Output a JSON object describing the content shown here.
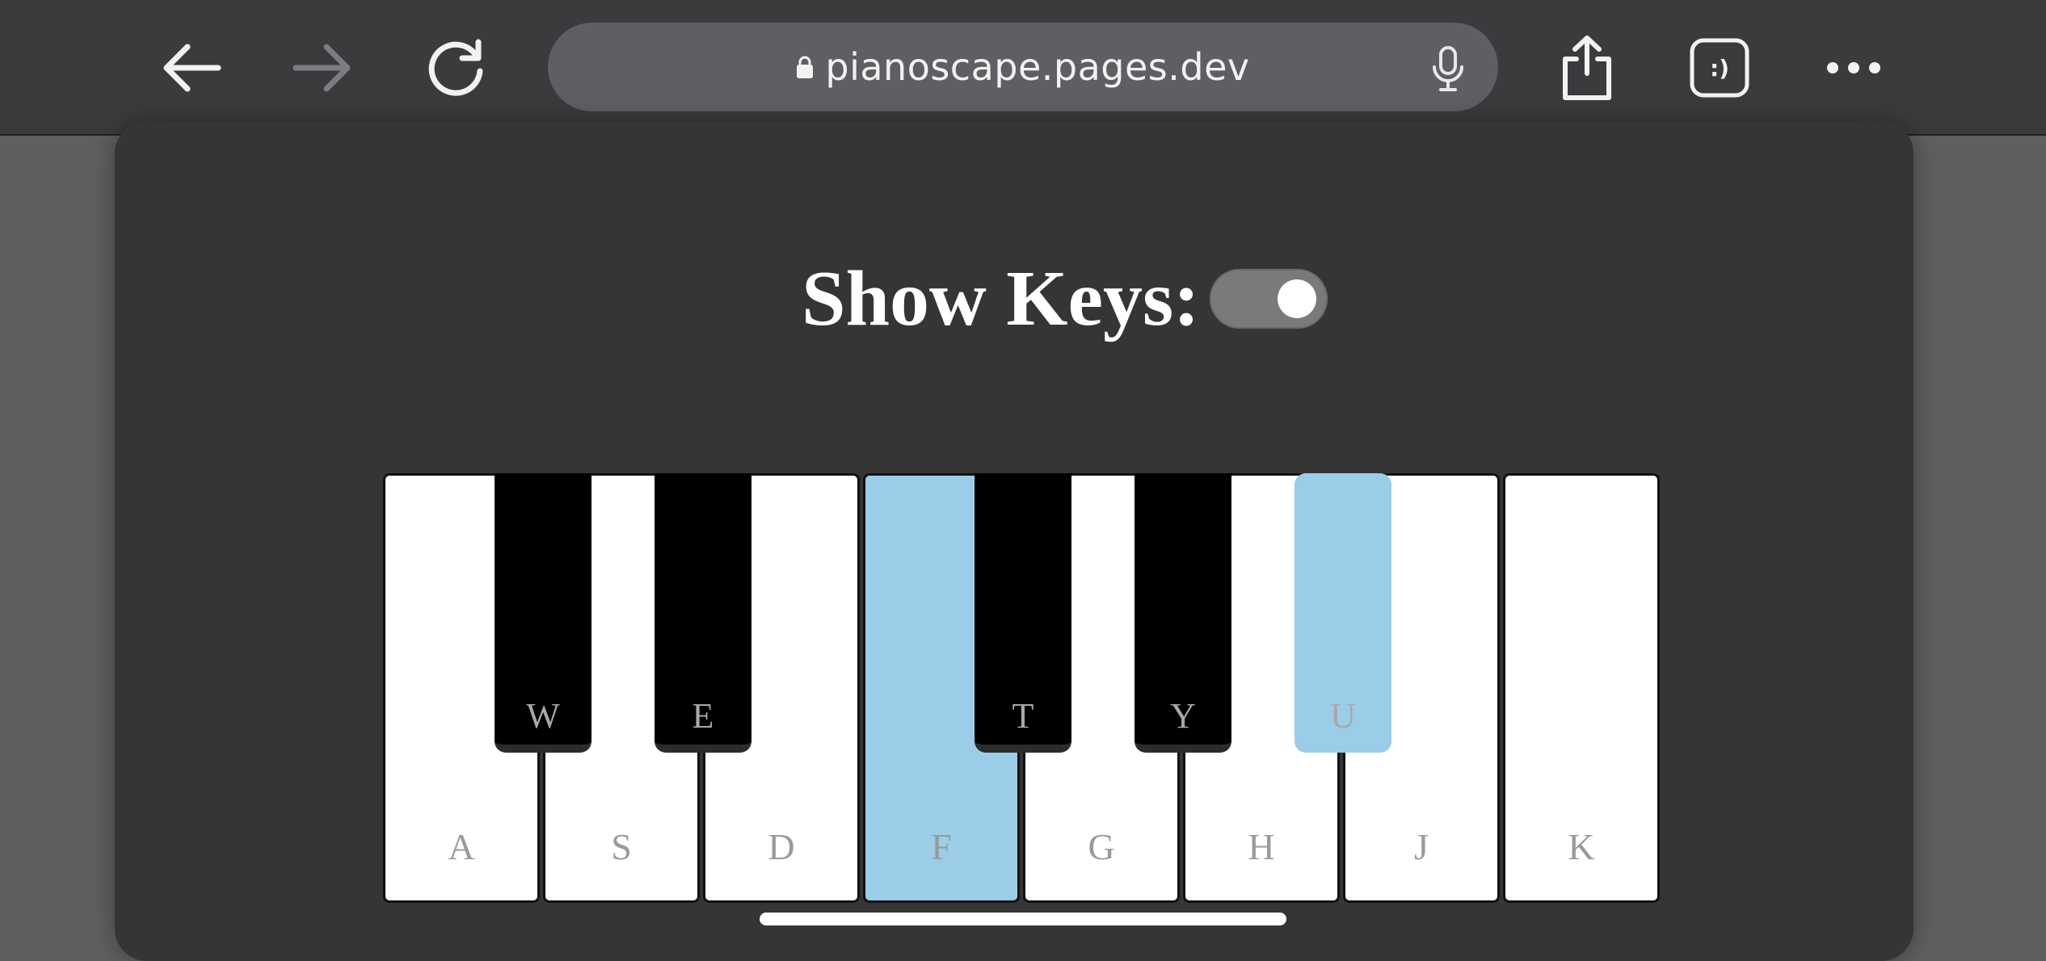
{
  "browser": {
    "url": "pianoscape.pages.dev",
    "back_icon": "arrow-left-icon",
    "forward_icon": "arrow-right-icon",
    "reload_icon": "reload-icon",
    "mic_icon": "microphone-icon",
    "share_icon": "share-icon",
    "tabs_icon": "tabs-icon",
    "tabs_glyph": ":)",
    "more_icon": "more-icon",
    "forward_enabled": false
  },
  "page": {
    "show_keys_label": "Show Keys:",
    "show_keys_enabled": true
  },
  "piano": {
    "white_keys": [
      {
        "label": "A",
        "active": false
      },
      {
        "label": "S",
        "active": false
      },
      {
        "label": "D",
        "active": false
      },
      {
        "label": "F",
        "active": true
      },
      {
        "label": "G",
        "active": false
      },
      {
        "label": "H",
        "active": false
      },
      {
        "label": "J",
        "active": false
      },
      {
        "label": "K",
        "active": false
      }
    ],
    "black_keys": [
      {
        "label": "W",
        "active": false
      },
      {
        "label": "E",
        "active": false
      },
      {
        "label": "T",
        "active": false
      },
      {
        "label": "Y",
        "active": false
      },
      {
        "label": "U",
        "active": true
      }
    ]
  },
  "colors": {
    "active_key": "#9bcde8",
    "page_background": "#353535",
    "toolbar_background": "#3a3b3d"
  }
}
